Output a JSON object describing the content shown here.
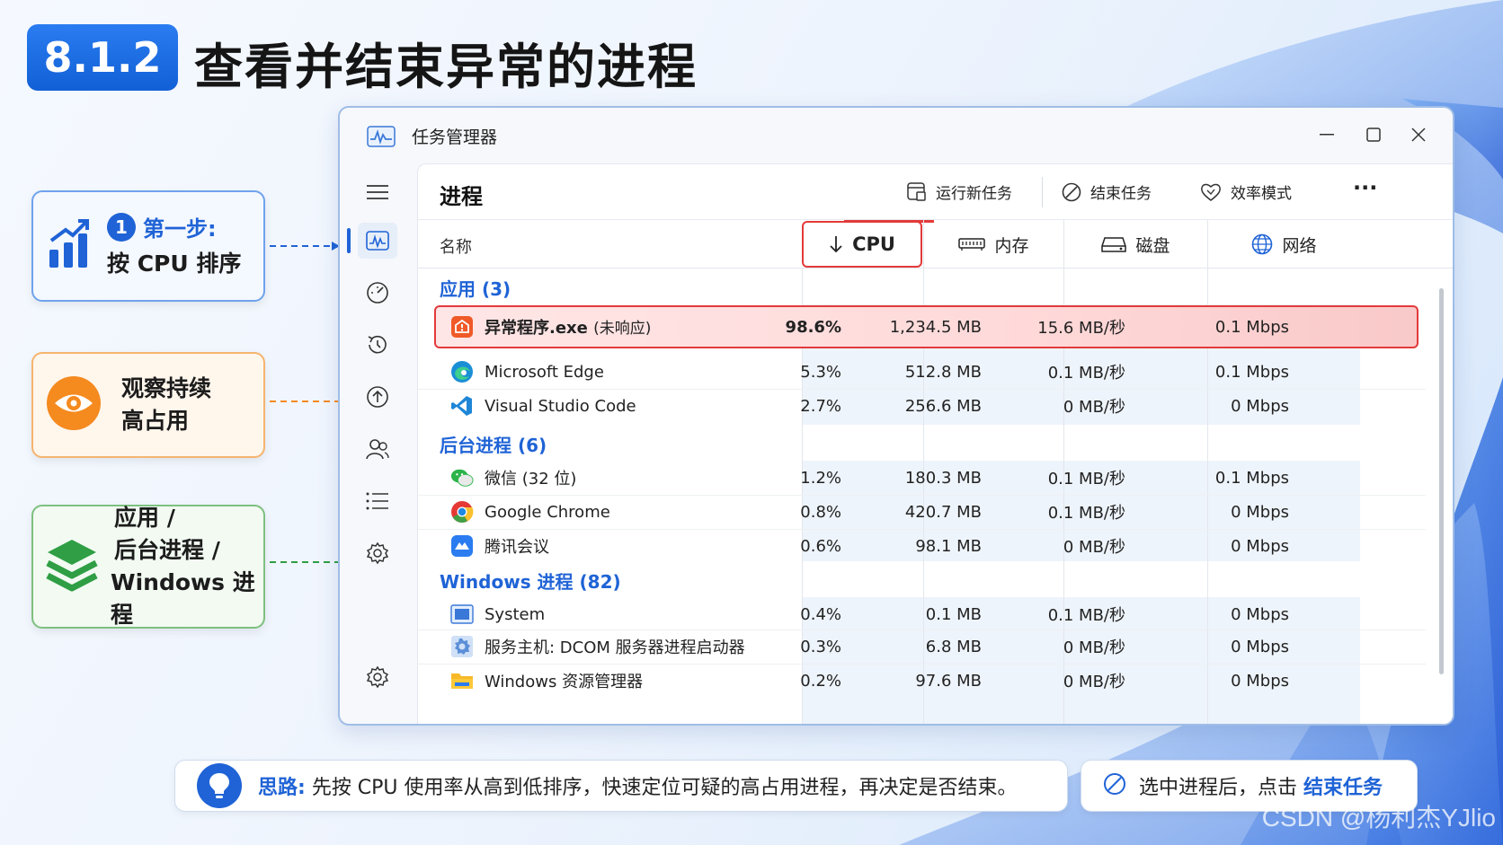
{
  "title": {
    "badge": "8.1.2",
    "text": "查看并结束异常的进程"
  },
  "cards": {
    "step1": {
      "step_num": "1",
      "step_label": "第一步:",
      "text": "按 CPU 排序"
    },
    "observe": {
      "line1": "观察持续",
      "line2": "高占用"
    },
    "groups": {
      "line1": "应用 /",
      "line2": "后台进程 /",
      "line3": "Windows 进程"
    }
  },
  "window": {
    "app_title": "任务管理器",
    "page_title": "进程",
    "toolbar": {
      "run_new": "运行新任务",
      "end_task": "结束任务",
      "efficiency": "效率模式",
      "more": "···"
    },
    "columns": {
      "name": "名称",
      "cpu": "CPU",
      "memory": "内存",
      "disk": "磁盘",
      "network": "网络"
    },
    "groups": {
      "apps": "应用 (3)",
      "background": "后台进程 (6)",
      "windows": "Windows 进程 (82)"
    },
    "highlight": {
      "name": "异常程序.exe",
      "status": "(未响应)",
      "cpu": "98.6%",
      "memory": "1,234.5 MB",
      "disk": "15.6 MB/秒",
      "network": "0.1 Mbps"
    },
    "rows": [
      {
        "name": "Microsoft Edge",
        "cpu": "5.3%",
        "memory": "512.8 MB",
        "disk": "0.1 MB/秒",
        "network": "0.1 Mbps"
      },
      {
        "name": "Visual Studio Code",
        "cpu": "2.7%",
        "memory": "256.6 MB",
        "disk": "0 MB/秒",
        "network": "0 Mbps"
      },
      {
        "name": "微信 (32 位)",
        "cpu": "1.2%",
        "memory": "180.3 MB",
        "disk": "0.1 MB/秒",
        "network": "0.1 Mbps"
      },
      {
        "name": "Google Chrome",
        "cpu": "0.8%",
        "memory": "420.7 MB",
        "disk": "0.1 MB/秒",
        "network": "0 Mbps"
      },
      {
        "name": "腾讯会议",
        "cpu": "0.6%",
        "memory": "98.1 MB",
        "disk": "0 MB/秒",
        "network": "0 Mbps"
      },
      {
        "name": "System",
        "cpu": "0.4%",
        "memory": "0.1 MB",
        "disk": "0.1 MB/秒",
        "network": "0 Mbps"
      },
      {
        "name": "服务主机: DCOM 服务器进程启动器",
        "cpu": "0.3%",
        "memory": "6.8 MB",
        "disk": "0 MB/秒",
        "network": "0 Mbps"
      },
      {
        "name": "Windows 资源管理器",
        "cpu": "0.2%",
        "memory": "97.6 MB",
        "disk": "0 MB/秒",
        "network": "0 Mbps"
      }
    ]
  },
  "tips": {
    "left_label": "思路:",
    "left_text": "先按 CPU 使用率从高到低排序，快速定位可疑的高占用进程，再决定是否结束。",
    "right_text": "选中进程后，点击 ",
    "right_emph": "结束任务"
  },
  "watermark": "CSDN @杨利杰YJlio",
  "colors": {
    "accent": "#1f63d6",
    "alert": "#e33a3a"
  }
}
